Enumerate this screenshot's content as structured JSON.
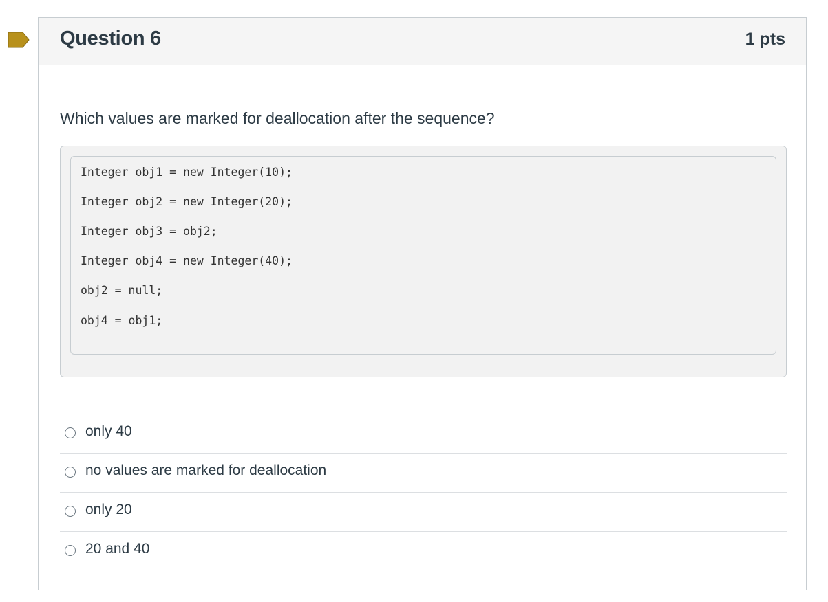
{
  "question": {
    "title": "Question 6",
    "points": "1 pts",
    "prompt": "Which values are marked for deallocation after the sequence?",
    "flag_color": "#b8911c",
    "code_lines": [
      "Integer obj1 = new Integer(10);",
      "Integer obj2 = new Integer(20);",
      "Integer obj3 = obj2;",
      "Integer obj4 = new Integer(40);",
      "obj2 = null;",
      "obj4 = obj1;"
    ],
    "answers": [
      {
        "label": "only 40",
        "selected": false
      },
      {
        "label": "no values are marked for deallocation",
        "selected": false
      },
      {
        "label": "only 20",
        "selected": false
      },
      {
        "label": "20 and 40",
        "selected": false
      }
    ]
  }
}
